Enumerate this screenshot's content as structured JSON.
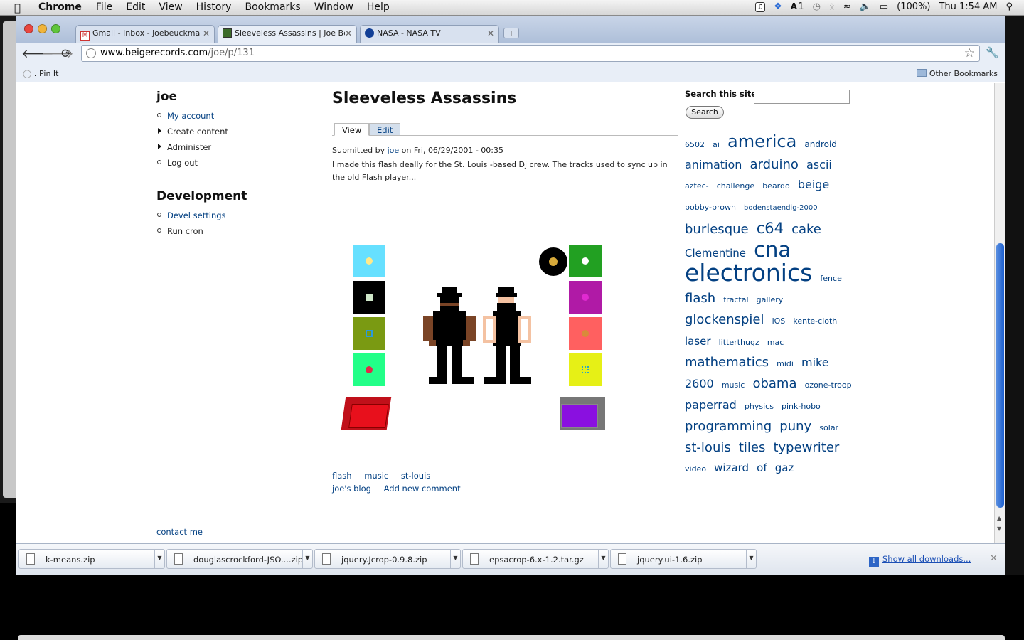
{
  "menubar": {
    "app": "Chrome",
    "menus": [
      "File",
      "Edit",
      "View",
      "History",
      "Bookmarks",
      "Window",
      "Help"
    ],
    "battery": "(100%)",
    "clock": "Thu 1:54 AM",
    "input_indicator": "1"
  },
  "tabs": [
    {
      "label": "Gmail - Inbox - joebeuckma",
      "favicon": "gmail-icon"
    },
    {
      "label": "Sleeveless Assassins | Joe Be",
      "favicon": "site-icon"
    },
    {
      "label": "NASA - NASA TV",
      "favicon": "nasa-icon"
    }
  ],
  "address": {
    "host": "www.beigerecords.com",
    "path": "/joe/p/131"
  },
  "bookmarks": {
    "pin_label": "Pin It",
    "other_label": "Other Bookmarks"
  },
  "sidebar": {
    "user_title": "joe",
    "user_items": [
      "My account",
      "Create content",
      "Administer",
      "Log out"
    ],
    "dev_title": "Development",
    "dev_items": [
      "Devel settings",
      "Run cron"
    ],
    "contact": "contact me"
  },
  "node": {
    "title": "Sleeveless Assassins",
    "tab_view": "View",
    "tab_edit": "Edit",
    "submitted_prefix": "Submitted by",
    "author": "joe",
    "submitted_date": "on Fri, 06/29/2001 - 00:35",
    "body": "I made this flash deally for the St. Louis -based Dj crew. The tracks used to sync up in the old Flash player...",
    "terms": [
      "flash",
      "music",
      "st-louis"
    ],
    "links": [
      "joe's blog",
      "Add new comment"
    ]
  },
  "search": {
    "label": "Search this site:",
    "button": "Search",
    "value": ""
  },
  "tag_cloud": [
    {
      "t": "6502",
      "s": 11
    },
    {
      "t": "ai",
      "s": 11
    },
    {
      "t": "america",
      "s": 24
    },
    {
      "t": "android",
      "s": 12
    },
    {
      "t": "animation",
      "s": 16
    },
    {
      "t": "arduino",
      "s": 18
    },
    {
      "t": "ascii",
      "s": 16
    },
    {
      "t": "aztec-",
      "s": 11
    },
    {
      "t": "challenge",
      "s": 11
    },
    {
      "t": "beardo",
      "s": 11
    },
    {
      "t": "beige",
      "s": 16
    },
    {
      "t": "bobby-brown",
      "s": 11
    },
    {
      "t": "bodenstaendig-2000",
      "s": 10
    },
    {
      "t": "burlesque",
      "s": 18
    },
    {
      "t": "c64",
      "s": 21
    },
    {
      "t": "cake",
      "s": 18
    },
    {
      "t": "Clementine",
      "s": 15
    },
    {
      "t": "cna",
      "s": 29
    },
    {
      "t": "electronics",
      "s": 33
    },
    {
      "t": "fence",
      "s": 11
    },
    {
      "t": "flash",
      "s": 18
    },
    {
      "t": "fractal",
      "s": 11
    },
    {
      "t": "gallery",
      "s": 11
    },
    {
      "t": "glockenspiel",
      "s": 18
    },
    {
      "t": "iOS",
      "s": 11
    },
    {
      "t": "kente-cloth",
      "s": 11
    },
    {
      "t": "laser",
      "s": 15
    },
    {
      "t": "litterthugz",
      "s": 11
    },
    {
      "t": "mac",
      "s": 11
    },
    {
      "t": "mathematics",
      "s": 18
    },
    {
      "t": "midi",
      "s": 11
    },
    {
      "t": "mike",
      "s": 16
    },
    {
      "t": "2600",
      "s": 16
    },
    {
      "t": "music",
      "s": 11
    },
    {
      "t": "obama",
      "s": 18
    },
    {
      "t": "ozone-troop",
      "s": 11
    },
    {
      "t": "paperrad",
      "s": 16
    },
    {
      "t": "physics",
      "s": 11
    },
    {
      "t": "pink-hobo",
      "s": 11
    },
    {
      "t": "programming",
      "s": 18
    },
    {
      "t": "puny",
      "s": 18
    },
    {
      "t": "solar",
      "s": 11
    },
    {
      "t": "st-louis",
      "s": 18
    },
    {
      "t": "tiles",
      "s": 18
    },
    {
      "t": "typewriter",
      "s": 18
    },
    {
      "t": "video",
      "s": 11
    },
    {
      "t": "wizard",
      "s": 15
    },
    {
      "t": "of",
      "s": 15
    },
    {
      "t": "gaz",
      "s": 15
    }
  ],
  "downloads": {
    "items": [
      "k-means.zip",
      "douglascrockford-JSO....zip",
      "jquery.Jcrop-0.9.8.zip",
      "epsacrop-6.x-1.2.tar.gz",
      "jquery.ui-1.6.zip"
    ],
    "show_all": "Show all downloads..."
  },
  "colors": {
    "link": "#034082",
    "tile_cyan": "#66e0ff",
    "tile_olive": "#7a9a12",
    "tile_green": "#22ff88",
    "tile_dkgreen": "#22a022",
    "tile_magenta": "#b01aa6",
    "tile_salmon": "#ff6060",
    "tile_yellow": "#e6f016",
    "box_red": "#e8101c",
    "box_purple": "#8a10e0",
    "skin_brown": "#7a4426",
    "skin_peach": "#f4c2a2"
  }
}
